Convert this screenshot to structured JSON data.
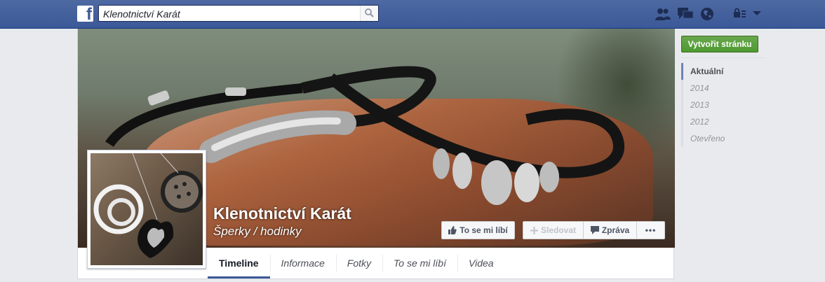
{
  "topbar": {
    "logo_letter": "f",
    "search_value": "Klenotnictví Karát",
    "icons": [
      "friend-requests-icon",
      "messages-icon",
      "notifications-globe-icon",
      "privacy-icon",
      "account-menu-chevron-icon"
    ]
  },
  "page": {
    "name": "Klenotnictví Karát",
    "category": "Šperky / hodinky"
  },
  "actions": {
    "like_label": "To se mi líbí",
    "follow_label": "Sledovat",
    "message_label": "Zpráva",
    "more_label": "•••"
  },
  "tabs": [
    {
      "label": "Timeline"
    },
    {
      "label": "Informace"
    },
    {
      "label": "Fotky"
    },
    {
      "label": "To se mi líbí"
    },
    {
      "label": "Videa"
    }
  ],
  "sidebar": {
    "create_page_label": "Vytvořit stránku",
    "years": [
      {
        "label": "Aktuální"
      },
      {
        "label": "2014"
      },
      {
        "label": "2013"
      },
      {
        "label": "2012"
      },
      {
        "label": "Otevřeno"
      }
    ]
  },
  "colors": {
    "brand": "#3b5998",
    "create_button": "#4e9a30"
  }
}
